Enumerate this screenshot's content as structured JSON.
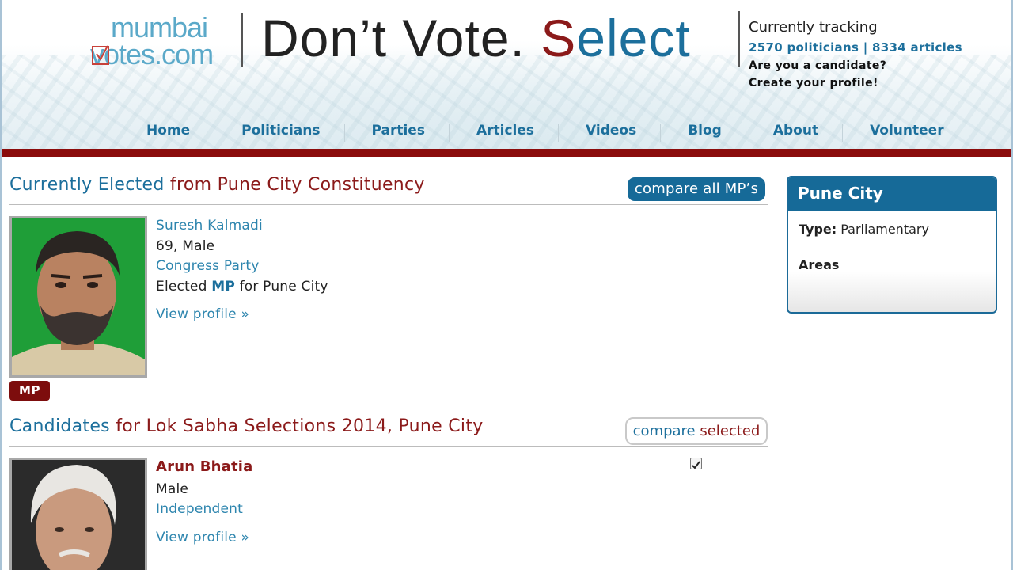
{
  "logo": {
    "line1": "mumbai",
    "line2": "votes.com"
  },
  "tagline": {
    "part1": "Don’t Vote. ",
    "s": "S",
    "rest": "elect"
  },
  "tracking": {
    "label": "Currently tracking",
    "stats": "2570 politicians | 8334 articles",
    "question": "Are you a candidate?",
    "cta": "Create your profile!"
  },
  "nav": [
    "Home",
    "Politicians",
    "Parties",
    "Articles",
    "Videos",
    "Blog",
    "About",
    "Volunteer"
  ],
  "elected": {
    "title_blue": "Currently Elected",
    "title_red": " from Pune City Constituency",
    "compare_button": "compare all MP’s",
    "mp": {
      "name": "Suresh Kalmadi",
      "age_gender": "69, Male",
      "party": "Congress Party",
      "elected_prefix": "Elected ",
      "elected_role": "MP",
      "elected_suffix": " for Pune City",
      "view_profile": "View profile »",
      "badge": "MP"
    }
  },
  "candidates": {
    "title_blue": "Candidates",
    "title_red": " for Lok Sabha Selections 2014, Pune City",
    "compare_button_a": "compare ",
    "compare_button_b": "selected",
    "items": [
      {
        "name": "Arun Bhatia",
        "gender": "Male",
        "party": "Independent",
        "view_profile": "View profile »",
        "selected": true
      }
    ]
  },
  "sidebar": {
    "title": "Pune City",
    "type_label": "Type:",
    "type_value": " Parliamentary",
    "areas_label": "Areas"
  },
  "colors": {
    "brand_blue": "#1c6f9c",
    "brand_red": "#8b1a1a",
    "bar_red": "#8b0c0c"
  }
}
